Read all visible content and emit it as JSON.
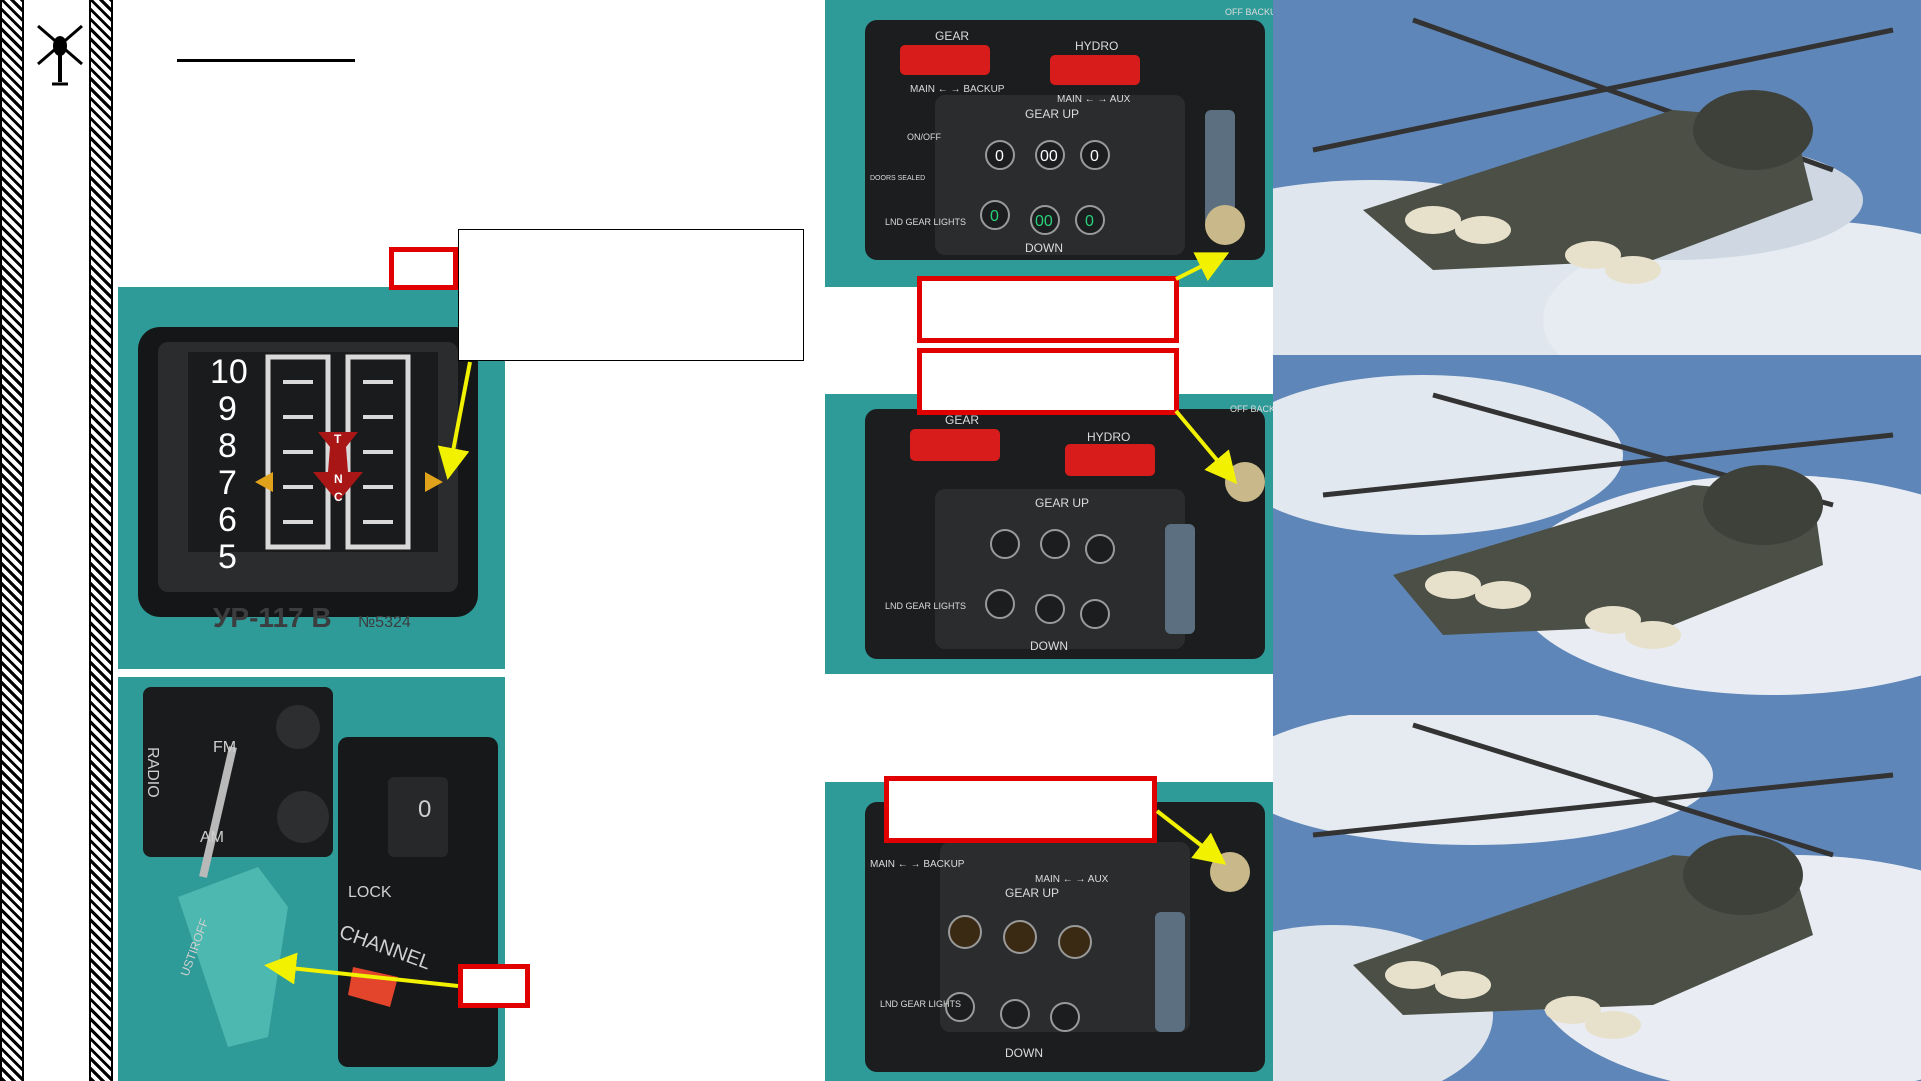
{
  "sidebar": {
    "logo_icon": "helicopter-icon"
  },
  "cockpit_labels": {
    "gauge_numbers": [
      "10",
      "9",
      "8",
      "7",
      "6",
      "5"
    ],
    "gauge_marks": [
      "T",
      "N",
      "C"
    ],
    "gauge_plate": "УР-117 В",
    "gauge_serial": "№5324",
    "gear_label": "GEAR",
    "hydro_label": "HYDRO",
    "main_backup": "MAIN ← → BACKUP",
    "main_aux": "MAIN ← → AUX",
    "gear_up": "GEAR UP",
    "down": "DOWN",
    "lnd_gear_lights": "LND GEAR LIGHTS",
    "off_backup": "OFF BACKUP",
    "on_off": "ON/OFF",
    "doors_sealed": "DOORS SEALED",
    "radio": "RADIO",
    "fm": "FM",
    "am": "AM",
    "channel": "CHANNEL",
    "lock": "LOCK",
    "ustiroff": "USTIROFF",
    "channel_digit": "0",
    "indicator_values_row1": [
      "0",
      "00",
      "0"
    ],
    "indicator_values_row2": [
      "0",
      "00",
      "0"
    ]
  },
  "colors": {
    "accent_red": "#e00000",
    "arrow_yellow": "#f2f200",
    "panel_teal": "#2f9b98",
    "panel_dark": "#1b1d1e",
    "warning_red": "#d81c1c",
    "indicator_green": "#2bd07a",
    "indicator_amber": "#f2a23a"
  }
}
